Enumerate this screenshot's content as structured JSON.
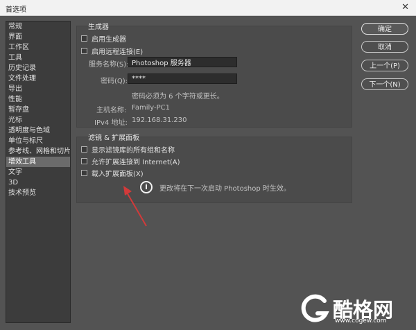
{
  "window": {
    "title": "首选项",
    "close_glyph": "✕"
  },
  "sidebar": {
    "items": [
      "常规",
      "界面",
      "工作区",
      "工具",
      "历史记录",
      "文件处理",
      "导出",
      "性能",
      "暂存盘",
      "光标",
      "透明度与色域",
      "单位与标尺",
      "参考线、网格和切片",
      "增效工具",
      "文字",
      "3D",
      "技术预览"
    ],
    "active_index": 13
  },
  "generator": {
    "title": "生成器",
    "enable_generator": "启用生成器",
    "enable_remote": "启用远程连接(E)",
    "service_name_label": "服务名称(S):",
    "service_name_value": "Photoshop 服务器",
    "password_label": "密码(Q):",
    "password_value": "****",
    "password_hint": "密码必须为 6 个字符或更长。",
    "hostname_label": "主机名称:",
    "hostname_value": "Family-PC1",
    "ipv4_label": "IPv4 地址:",
    "ipv4_value": "192.168.31.230"
  },
  "filters": {
    "title": "滤镜 & 扩展面板",
    "show_all_groups": "显示滤镜库的所有组和名称",
    "allow_internet": "允许扩展连接到 Internet(A)",
    "load_extensions": "载入扩展面板(X)",
    "restart_note": "更改将在下一次启动 Photoshop 时生效。"
  },
  "buttons": {
    "ok": "确定",
    "cancel": "取消",
    "prev": "上一个(P)",
    "next": "下一个(N)"
  },
  "watermark": {
    "brand": "酷格网",
    "url": "www.cogew.com"
  },
  "colors": {
    "background": "#535353",
    "sidebar": "#3c3c3c",
    "panel": "#4b4b4b",
    "arrow": "#d23a3a"
  }
}
